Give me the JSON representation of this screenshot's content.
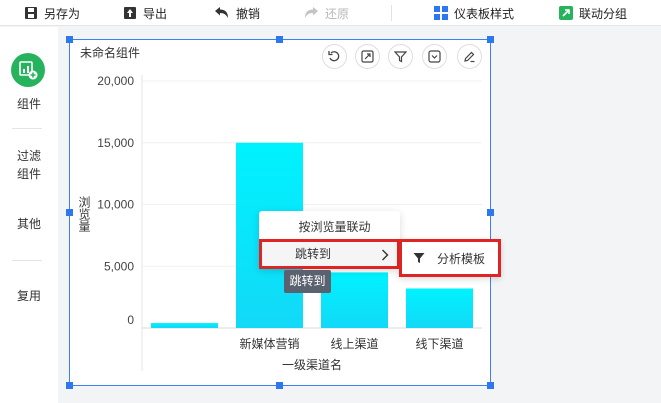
{
  "toolbar": {
    "save_as": "另存为",
    "export": "导出",
    "undo": "撤销",
    "redo": "还原",
    "dashboard_style": "仪表板样式",
    "linkage_group": "联动分组"
  },
  "sidebar": {
    "items": [
      {
        "label": "组件",
        "icon": "add-chart-icon"
      },
      {
        "label": "过滤\n组件"
      },
      {
        "label": "其他"
      },
      {
        "label": "复用"
      }
    ]
  },
  "widget": {
    "title": "未命名组件",
    "actions": [
      "undo-icon",
      "expand-icon",
      "filter-icon",
      "dropdown-icon",
      "edit-icon"
    ]
  },
  "context_menu": {
    "items": [
      "按浏览量联动",
      "跳转到"
    ],
    "tooltip": "跳转到",
    "submenu_item": "分析模板"
  },
  "colors": {
    "bar": "#00eeff",
    "bar_bottom": "#12d9f7",
    "highlight": "#e02424",
    "selection": "#2d78ee",
    "brand_green": "#27b35e"
  },
  "chart_data": {
    "type": "bar",
    "categories": [
      "",
      "新媒体营销",
      "线上渠道",
      "线下渠道"
    ],
    "values": [
      400,
      15000,
      4500,
      3200
    ],
    "xlabel": "一级渠道名",
    "ylabel": "浏览量",
    "ylim": [
      0,
      20000
    ],
    "yticks": [
      "20,000",
      "15,000",
      "10,000",
      "5,000",
      "0"
    ],
    "ytick_values": [
      20000,
      15000,
      10000,
      5000,
      0
    ],
    "grid": true
  }
}
